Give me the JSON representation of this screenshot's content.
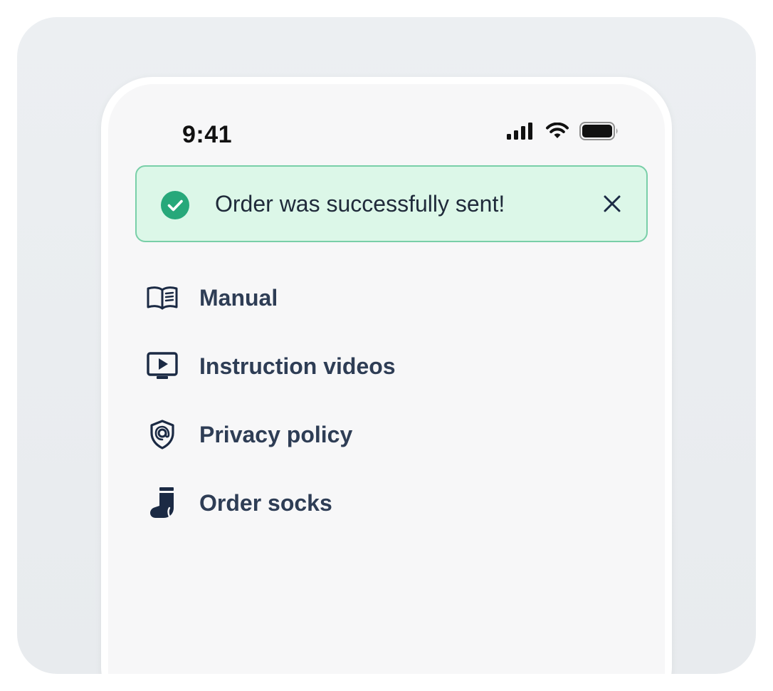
{
  "status_bar": {
    "time": "9:41",
    "icons": [
      "cellular-signal-icon",
      "wifi-icon",
      "battery-icon"
    ]
  },
  "toast": {
    "message": "Order was successfully sent!",
    "icon": "check-circle-icon",
    "close_icon": "close-icon",
    "colors": {
      "background": "#dcf7e8",
      "border": "#79cfa8",
      "check": "#27a87a"
    }
  },
  "menu": {
    "items": [
      {
        "label": "Manual",
        "icon": "book-icon"
      },
      {
        "label": "Instruction videos",
        "icon": "video-player-icon"
      },
      {
        "label": "Privacy policy",
        "icon": "privacy-shield-icon"
      },
      {
        "label": "Order socks",
        "icon": "sock-icon"
      }
    ],
    "colors": {
      "text": "#2e3d55",
      "icon": "#1b2a44"
    }
  }
}
